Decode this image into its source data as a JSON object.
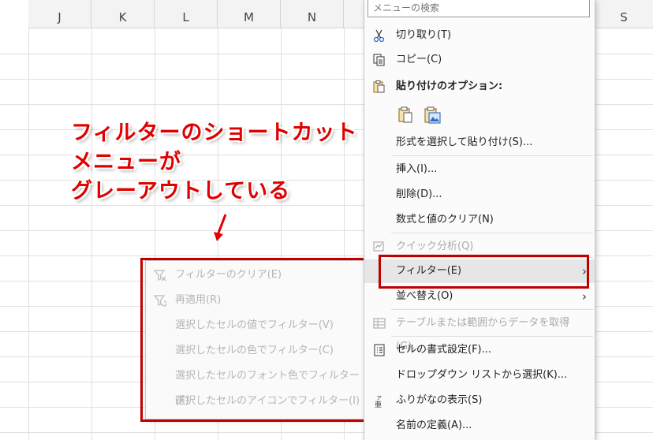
{
  "sheet": {
    "columns": [
      "J",
      "K",
      "L",
      "M",
      "N",
      "S"
    ]
  },
  "annotation": {
    "lines": [
      "フィルターのショートカット",
      "メニューが",
      "グレーアウトしている"
    ],
    "color": "#e00000"
  },
  "submenu": {
    "items": [
      {
        "label": "フィルターのクリア(E)",
        "icon": "filter-clear-icon"
      },
      {
        "label": "再適用(R)",
        "icon": "reapply-icon"
      },
      {
        "label": "選択したセルの値でフィルター(V)"
      },
      {
        "label": "選択したセルの色でフィルター(C)"
      },
      {
        "label": "選択したセルのフォント色でフィルター(F)"
      },
      {
        "label": "選択したセルのアイコンでフィルター(I)"
      }
    ]
  },
  "context_menu": {
    "search_placeholder": "メニューの検索",
    "items": [
      {
        "label": "切り取り(T)",
        "icon": "scissors-icon"
      },
      {
        "label": "コピー(C)",
        "icon": "copy-icon"
      },
      {
        "label": "貼り付けのオプション:",
        "icon": "clipboard-icon"
      },
      {
        "label": "形式を選択して貼り付け(S)..."
      },
      {
        "label": "挿入(I)..."
      },
      {
        "label": "削除(D)..."
      },
      {
        "label": "数式と値のクリア(N)"
      },
      {
        "label": "クイック分析(Q)",
        "icon": "quick-analysis-icon"
      },
      {
        "label": "フィルター(E)"
      },
      {
        "label": "並べ替え(O)"
      },
      {
        "label": "テーブルまたは範囲からデータを取得(G)...",
        "icon": "table-icon"
      },
      {
        "label": "セルの書式設定(F)...",
        "icon": "format-cells-icon"
      },
      {
        "label": "ドロップダウン リストから選択(K)..."
      },
      {
        "label": "ふりがなの表示(S)",
        "icon": "furigana-icon"
      },
      {
        "label": "名前の定義(A)..."
      }
    ]
  }
}
